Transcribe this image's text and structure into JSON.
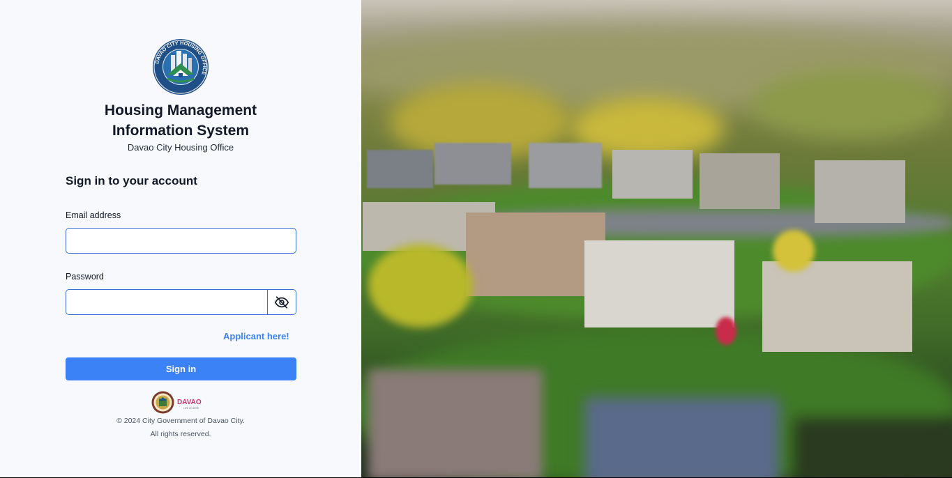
{
  "brand": {
    "title_line1": "Housing Management",
    "title_line2": "Information System",
    "subtitle": "Davao City Housing Office",
    "logo_icon": "davao-city-housing-office-seal",
    "logo_ring_text": "DAVAO CITY HOUSING OFFICE"
  },
  "form": {
    "heading": "Sign in to your account",
    "email_label": "Email address",
    "email_value": "",
    "password_label": "Password",
    "password_value": "",
    "toggle_icon": "eye-off-icon",
    "applicant_link": "Applicant here!",
    "signin_label": "Sign in"
  },
  "footer": {
    "line1": "© 2024 City Government of Davao City.",
    "line2": "All rights reserved.",
    "seal_icon": "city-seal",
    "davao_logo_text": "DAVAO",
    "davao_tagline": "LIFE IS HERE"
  },
  "colors": {
    "accent": "#3b82f6",
    "input_border": "#3b6fd6",
    "panel_bg": "#f7f9fc"
  }
}
